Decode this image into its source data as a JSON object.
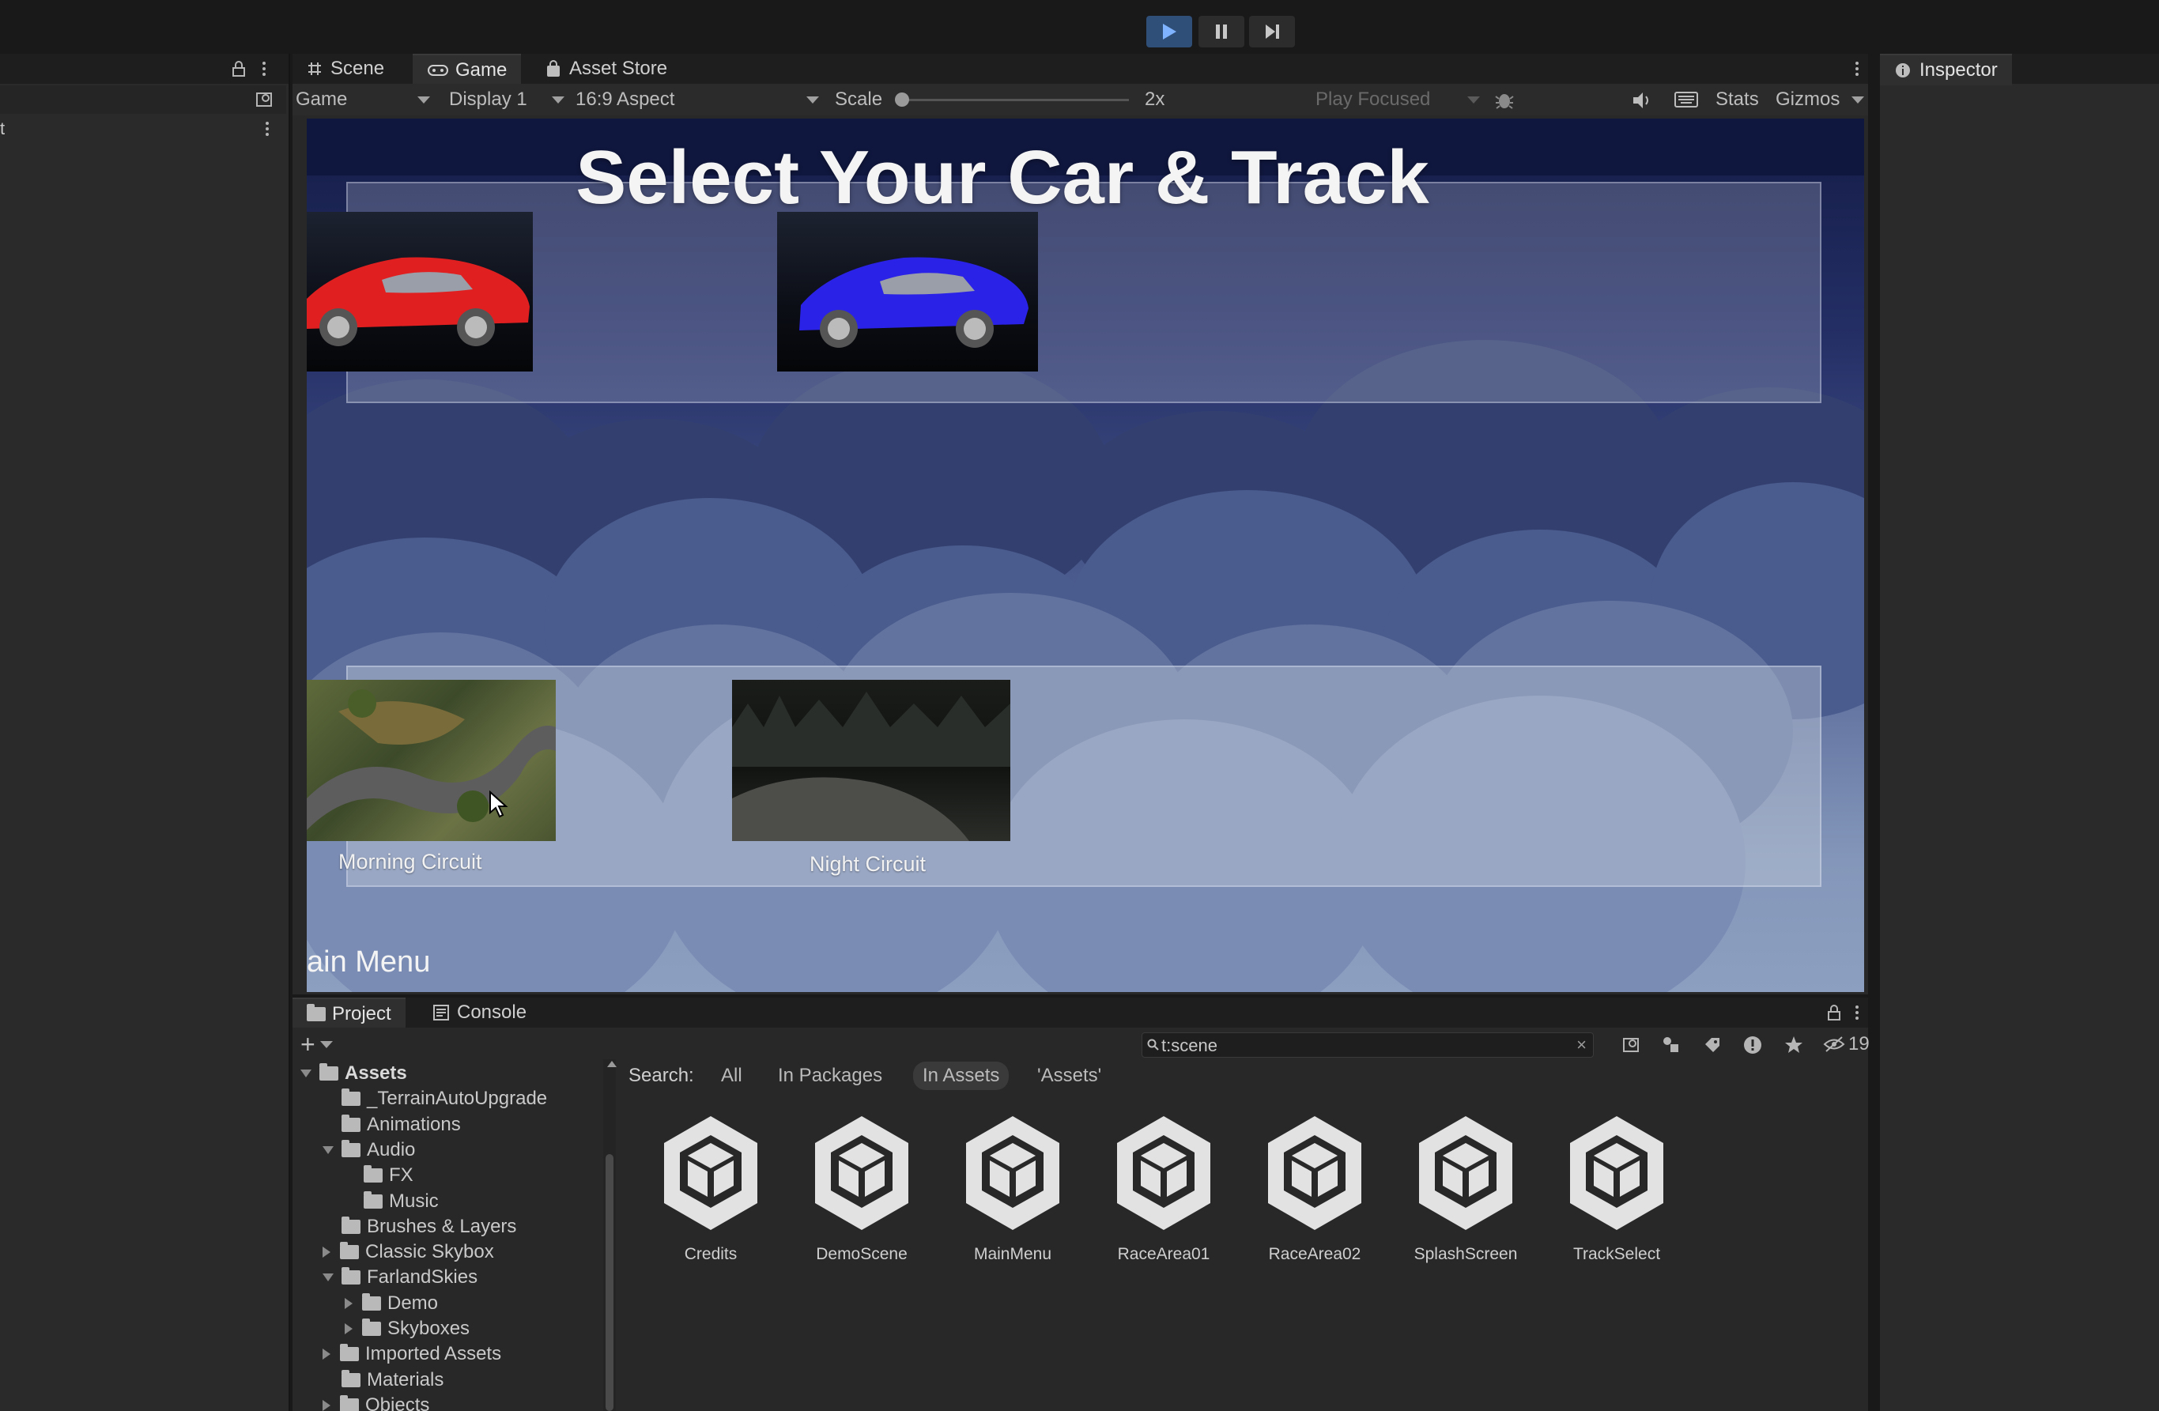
{
  "toolbar": {
    "play_icon": "play-icon",
    "pause_icon": "pause-icon",
    "step_icon": "step-icon"
  },
  "game_panel": {
    "tabs": [
      "Scene",
      "Game",
      "Asset Store"
    ],
    "display_mode": "Game",
    "display": "Display 1",
    "aspect": "16:9 Aspect",
    "scale_label": "Scale",
    "scale_value": "2x",
    "play_focused": "Play Focused",
    "stats": "Stats",
    "gizmos": "Gizmos"
  },
  "inspector": {
    "tab": "Inspector"
  },
  "left_panel": {
    "fragment": "t"
  },
  "game": {
    "title": "Select Your Car & Track",
    "tracks": [
      "Morning Circuit",
      "Night Circuit"
    ],
    "main_menu": "ain Menu",
    "car_colors": {
      "red": "#e02020",
      "blue": "#2a22e6"
    }
  },
  "project": {
    "tabs": [
      "Project",
      "Console"
    ],
    "search_query": "t:scene",
    "hidden_count": "19",
    "search_label": "Search:",
    "filters": [
      "All",
      "In Packages",
      "In Assets",
      "'Assets'"
    ],
    "tree": [
      {
        "label": "Assets",
        "indent": 0,
        "arrow": "down",
        "bold": true
      },
      {
        "label": "_TerrainAutoUpgrade",
        "indent": 1,
        "arrow": "none"
      },
      {
        "label": "Animations",
        "indent": 1,
        "arrow": "none"
      },
      {
        "label": "Audio",
        "indent": 1,
        "arrow": "down"
      },
      {
        "label": "FX",
        "indent": 2,
        "arrow": "none"
      },
      {
        "label": "Music",
        "indent": 2,
        "arrow": "none"
      },
      {
        "label": "Brushes & Layers",
        "indent": 1,
        "arrow": "none"
      },
      {
        "label": "Classic Skybox",
        "indent": 1,
        "arrow": "right"
      },
      {
        "label": "FarlandSkies",
        "indent": 1,
        "arrow": "down"
      },
      {
        "label": "Demo",
        "indent": 2,
        "arrow": "right"
      },
      {
        "label": "Skyboxes",
        "indent": 2,
        "arrow": "right"
      },
      {
        "label": "Imported Assets",
        "indent": 1,
        "arrow": "right"
      },
      {
        "label": "Materials",
        "indent": 1,
        "arrow": "none"
      },
      {
        "label": "Objects",
        "indent": 1,
        "arrow": "right"
      }
    ],
    "assets": [
      "Credits",
      "DemoScene",
      "MainMenu",
      "RaceArea01",
      "RaceArea02",
      "SplashScreen",
      "TrackSelect"
    ]
  }
}
